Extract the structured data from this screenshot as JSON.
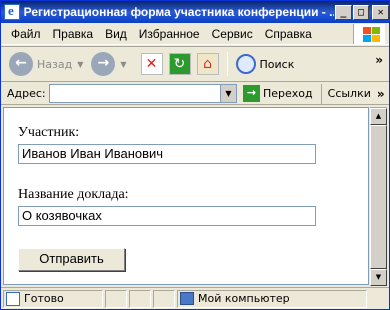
{
  "window": {
    "title": "Регистрационная форма участника конференции - ...",
    "buttons": {
      "minimize": "_",
      "maximize": "□",
      "close": "✕"
    }
  },
  "menu": {
    "items": [
      {
        "label": "Файл"
      },
      {
        "label": "Правка"
      },
      {
        "label": "Вид"
      },
      {
        "label": "Избранное"
      },
      {
        "label": "Сервис"
      },
      {
        "label": "Справка"
      }
    ]
  },
  "toolbar": {
    "back_label": "Назад",
    "search_label": "Поиск",
    "more": "»"
  },
  "address": {
    "label": "Адрес:",
    "value": "",
    "go_label": "Переход",
    "links_label": "Ссылки",
    "links_more": "»"
  },
  "form": {
    "participant_label": "Участник:",
    "participant_value": "Иванов Иван Иванович",
    "report_label": "Название доклада:",
    "report_value": "О козявочках",
    "submit_label": "Отправить"
  },
  "status": {
    "text": "Готово",
    "zone": "Мой компьютер"
  },
  "colors": {
    "titlebar": "#0a246a",
    "chrome": "#ece9d8",
    "input_border": "#7f9db9"
  }
}
